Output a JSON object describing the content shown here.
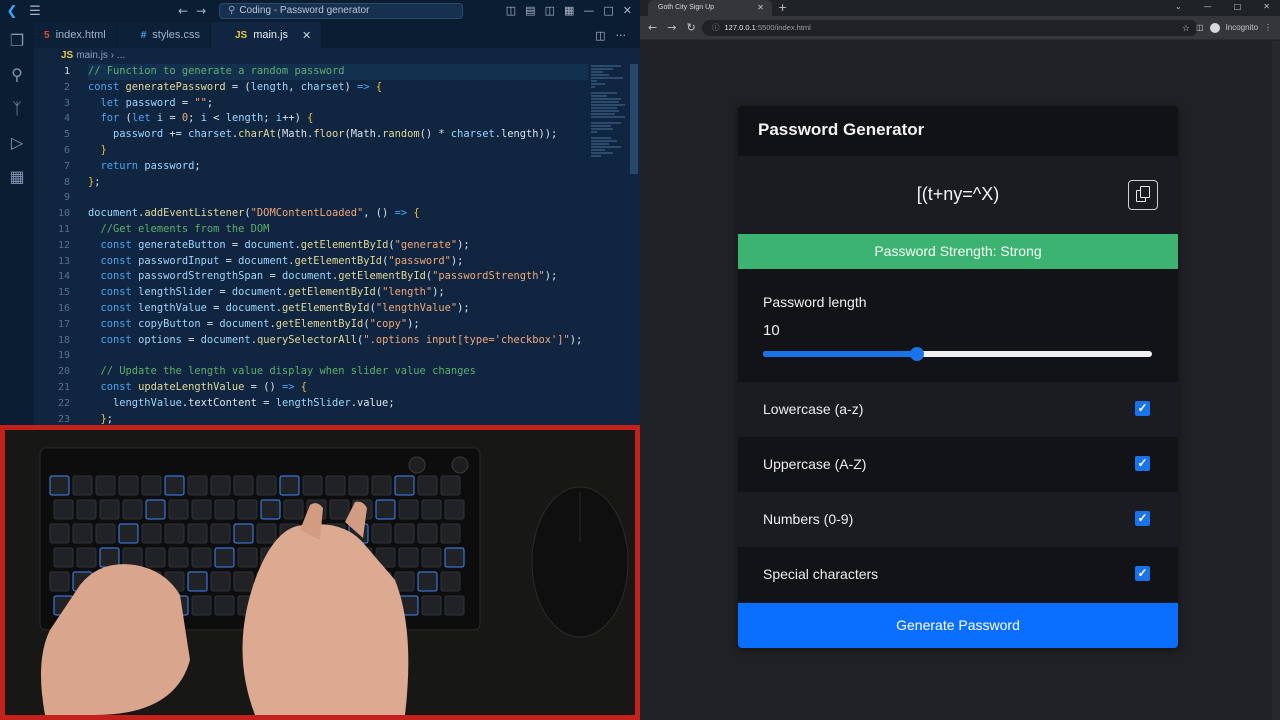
{
  "vscode": {
    "search_text": "Coding - Password generator",
    "tabs": [
      {
        "label": "index.html"
      },
      {
        "label": "styles.css"
      },
      {
        "label": "main.js"
      }
    ],
    "breadcrumb": "main.js",
    "breadcrumb_more": "...",
    "line_numbers": [
      "1",
      "2",
      "3",
      "4",
      "5",
      "6",
      "7",
      "8",
      "9",
      "10",
      "11",
      "12",
      "13",
      "14",
      "15",
      "16",
      "17",
      "18",
      "19",
      "20",
      "21",
      "22",
      "23"
    ]
  },
  "browser": {
    "tab_title": "Goth City Sign Up",
    "url_host": "127.0.0.1",
    "url_rest": ":5500/index.html",
    "profile_label": "Incognito"
  },
  "app": {
    "title": "Password Generator",
    "password": "[(t+ny=^X)",
    "strength_text": "Password Strength: Strong",
    "strength_color": "#3cb371",
    "length_label": "Password length",
    "length_value": "10",
    "slider_fraction": 0.397,
    "options": [
      {
        "label": "Lowercase (a-z)",
        "checked": true
      },
      {
        "label": "Uppercase (A-Z)",
        "checked": true
      },
      {
        "label": "Numbers (0-9)",
        "checked": true
      },
      {
        "label": "Special characters",
        "checked": true
      }
    ],
    "generate_label": "Generate Password",
    "accent_color": "#1a73e8"
  }
}
